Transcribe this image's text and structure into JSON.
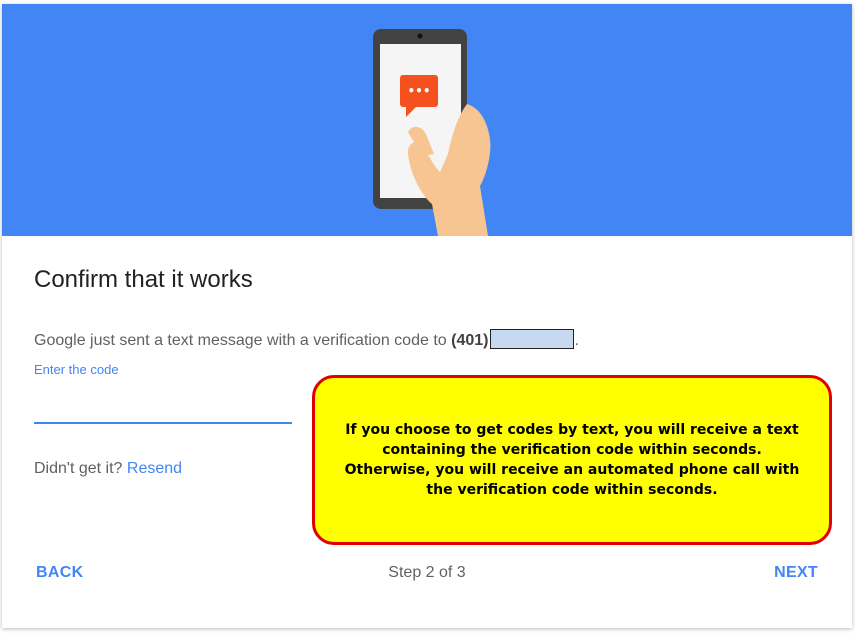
{
  "hero": {
    "icon": "phone-with-chat-bubble-icon",
    "chat_dots": "•••",
    "colors": {
      "background": "#4285f4",
      "bubble": "#f4511e"
    }
  },
  "title": "Confirm that it works",
  "message": {
    "text": "Google just sent a text message with a verification code to",
    "area_code": "(401)",
    "end": "."
  },
  "code_field": {
    "label": "Enter the code",
    "value": ""
  },
  "resend": {
    "prompt": "Didn't get it?",
    "link": "Resend"
  },
  "callout": {
    "text": "If you choose to get codes by text, you will receive a text containing the verification code within seconds. Otherwise, you will receive an automated phone call with the verification code within seconds."
  },
  "footer": {
    "back": "BACK",
    "step": "Step 2 of 3",
    "next": "NEXT"
  }
}
